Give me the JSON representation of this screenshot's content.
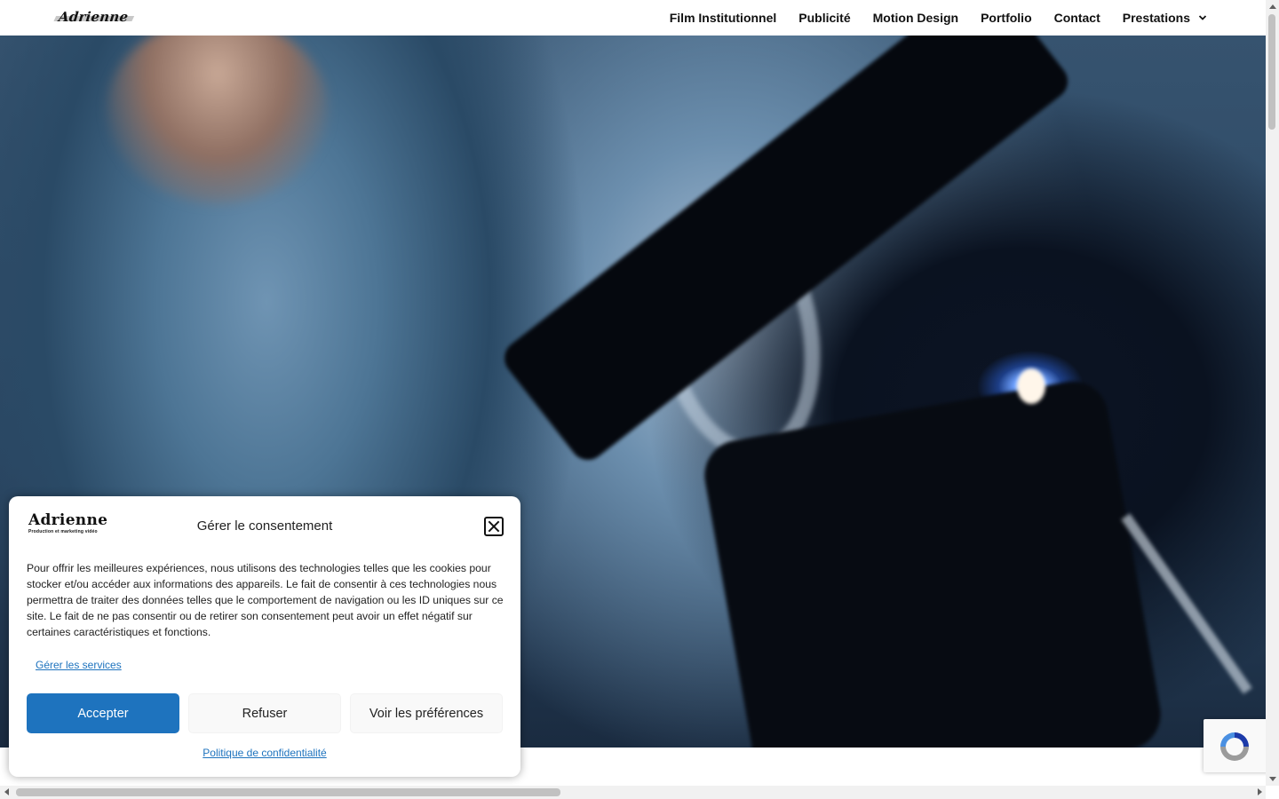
{
  "header": {
    "logo_text": "Adrienne",
    "nav": [
      "Film Institutionnel",
      "Publicité",
      "Motion Design",
      "Portfolio",
      "Contact",
      "Prestations"
    ]
  },
  "consent": {
    "logo_name": "Adrienne",
    "logo_tagline": "Production et marketing vidéo",
    "title": "Gérer le consentement",
    "body": "Pour offrir les meilleures expériences, nous utilisons des technologies telles que les cookies pour stocker et/ou accéder aux informations des appareils. Le fait de consentir à ces technologies nous permettra de traiter des données telles que le comportement de navigation ou les ID uniques sur ce site. Le fait de ne pas consentir ou de retirer son consentement peut avoir un effet négatif sur certaines caractéristiques et fonctions.",
    "manage_services": "Gérer les services",
    "accept": "Accepter",
    "refuse": "Refuser",
    "preferences": "Voir les préférences",
    "privacy_policy": "Politique de confidentialité"
  },
  "colors": {
    "accent": "#1e73be",
    "text": "#222222"
  }
}
